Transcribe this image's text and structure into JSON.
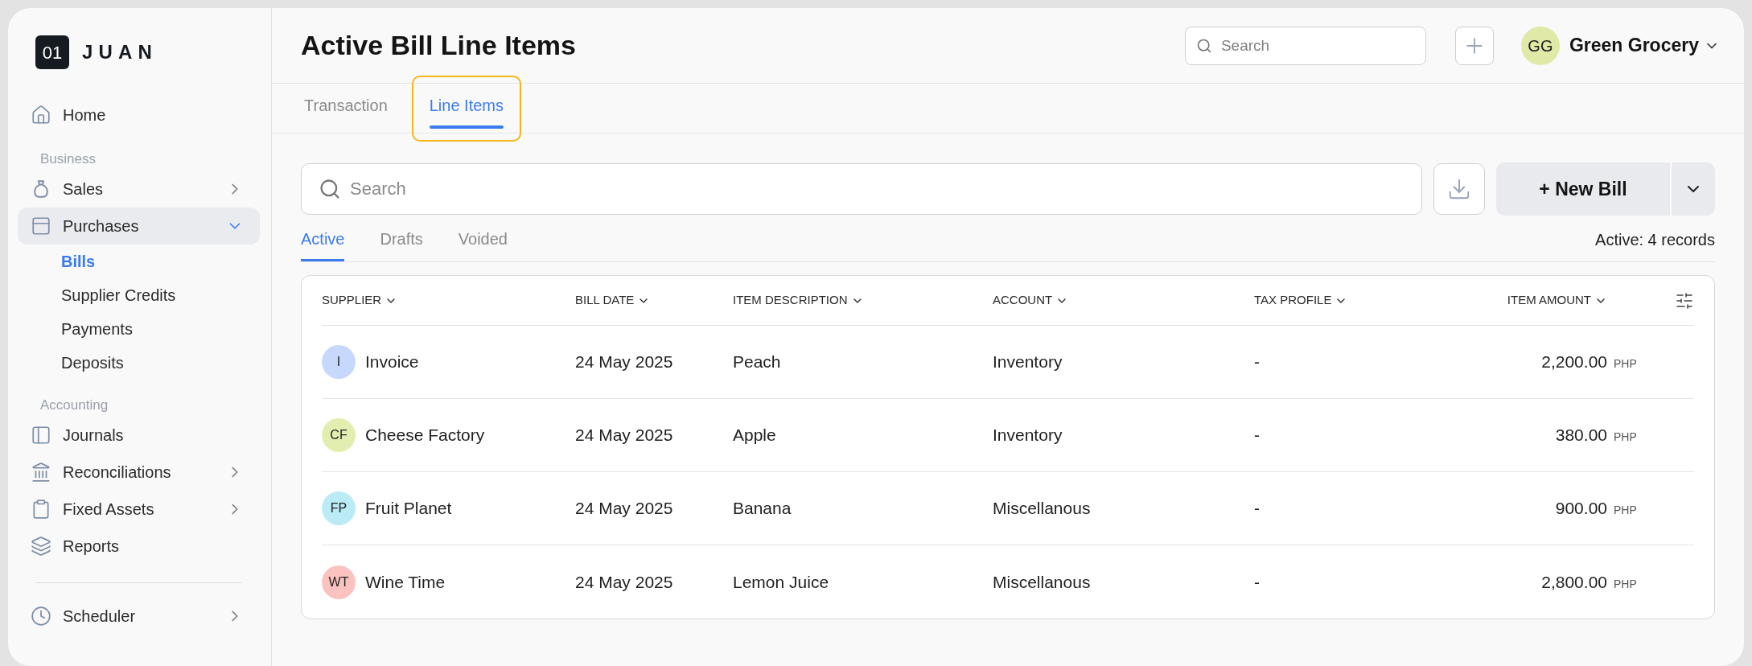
{
  "sidebar": {
    "logo": {
      "mark": "01",
      "name": "JUAN"
    },
    "sections": [
      {
        "items": [
          {
            "label": "Home",
            "kind": "link",
            "selected": false
          }
        ]
      },
      {
        "heading": "Business",
        "items": [
          {
            "label": "Sales",
            "kind": "group",
            "expanded": false,
            "selected": false
          },
          {
            "label": "Purchases",
            "kind": "group",
            "expanded": true,
            "selected": true,
            "children": [
              {
                "label": "Bills",
                "selected": true
              },
              {
                "label": "Supplier Credits",
                "selected": false
              },
              {
                "label": "Payments",
                "selected": false
              },
              {
                "label": "Deposits",
                "selected": false
              }
            ]
          }
        ]
      },
      {
        "heading": "Accounting",
        "items": [
          {
            "label": "Journals",
            "kind": "link",
            "selected": false
          },
          {
            "label": "Reconciliations",
            "kind": "group",
            "expanded": false,
            "selected": false
          },
          {
            "label": "Fixed Assets",
            "kind": "group",
            "expanded": false,
            "selected": false
          },
          {
            "label": "Reports",
            "kind": "link",
            "selected": false
          }
        ]
      },
      {
        "items": [
          {
            "label": "Scheduler",
            "kind": "group",
            "expanded": false,
            "selected": false
          }
        ]
      }
    ]
  },
  "header": {
    "title": "Active Bill Line Items",
    "search": {
      "placeholder": "Search"
    },
    "account": {
      "initials": "GG",
      "name": "Green Grocery",
      "color": "#e0eaa6"
    }
  },
  "tabs": [
    {
      "label": "Transaction",
      "selected": false,
      "focused": false
    },
    {
      "label": "Line Items",
      "selected": true,
      "focused": true
    }
  ],
  "toolbar": {
    "search": {
      "placeholder": "Search"
    },
    "new_button": "+ New Bill"
  },
  "status_tabs": [
    {
      "label": "Active",
      "selected": true
    },
    {
      "label": "Drafts",
      "selected": false
    },
    {
      "label": "Voided",
      "selected": false
    }
  ],
  "record_count": "Active: 4 records",
  "table": {
    "columns": [
      "SUPPLIER",
      "BILL DATE",
      "ITEM DESCRIPTION",
      "ACCOUNT",
      "TAX PROFILE",
      "ITEM AMOUNT"
    ],
    "rows": [
      {
        "initials": "I",
        "color": "#c6d8fc",
        "supplier": "Invoice",
        "date": "24 May 2025",
        "description": "Peach",
        "account": "Inventory",
        "tax": "-",
        "amount": "2,200.00",
        "currency": "PHP"
      },
      {
        "initials": "CF",
        "color": "#e2eeb0",
        "supplier": "Cheese Factory",
        "date": "24 May 2025",
        "description": "Apple",
        "account": "Inventory",
        "tax": "-",
        "amount": "380.00",
        "currency": "PHP"
      },
      {
        "initials": "FP",
        "color": "#bbecf6",
        "supplier": "Fruit Planet",
        "date": "24 May 2025",
        "description": "Banana",
        "account": "Miscellanous",
        "tax": "-",
        "amount": "900.00",
        "currency": "PHP"
      },
      {
        "initials": "WT",
        "color": "#fbc3bf",
        "supplier": "Wine Time",
        "date": "24 May 2025",
        "description": "Lemon Juice",
        "account": "Miscellanous",
        "tax": "-",
        "amount": "2,800.00",
        "currency": "PHP"
      }
    ]
  }
}
